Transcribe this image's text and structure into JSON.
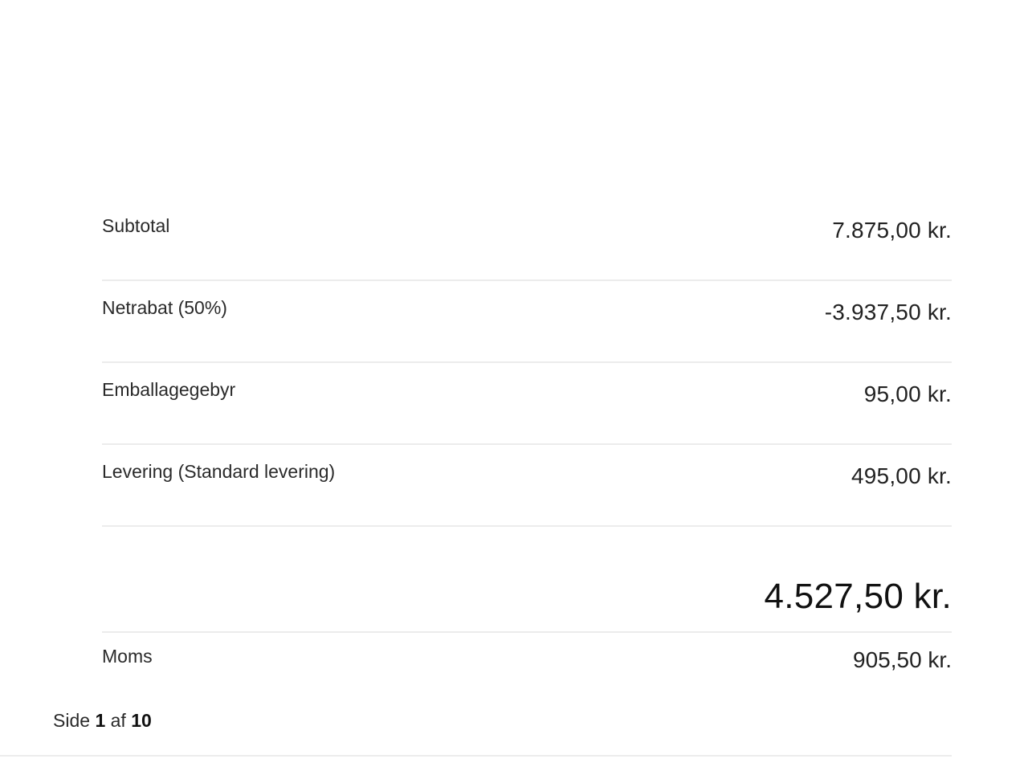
{
  "summary": {
    "rows": [
      {
        "label": "Subtotal",
        "value": "7.875,00 kr."
      },
      {
        "label": "Netrabat (50%)",
        "value": "-3.937,50 kr."
      },
      {
        "label": "Emballagegebyr",
        "value": "95,00 kr."
      },
      {
        "label": "Levering (Standard levering)",
        "value": "495,00 kr."
      }
    ],
    "total": "4.527,50 kr.",
    "vat": {
      "label": "Moms",
      "value": "905,50 kr."
    }
  },
  "pager": {
    "prefix": "Side",
    "current": "1",
    "separator": "af",
    "total": "10"
  }
}
